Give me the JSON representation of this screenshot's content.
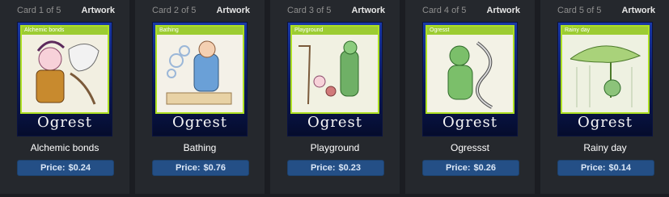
{
  "cards": [
    {
      "counter": "Card 1 of 5",
      "artwork_link": "Artwork",
      "mini_title": "Alchemic bonds",
      "logo": "Ogrest",
      "name": "Alchemic bonds",
      "price_label": "Price:",
      "price_value": "$0.24"
    },
    {
      "counter": "Card 2 of 5",
      "artwork_link": "Artwork",
      "mini_title": "Bathing",
      "logo": "Ogrest",
      "name": "Bathing",
      "price_label": "Price:",
      "price_value": "$0.76"
    },
    {
      "counter": "Card 3 of 5",
      "artwork_link": "Artwork",
      "mini_title": "Playground",
      "logo": "Ogrest",
      "name": "Playground",
      "price_label": "Price:",
      "price_value": "$0.23"
    },
    {
      "counter": "Card 4 of 5",
      "artwork_link": "Artwork",
      "mini_title": "Ogresst",
      "logo": "Ogrest",
      "name": "Ogressst",
      "price_label": "Price:",
      "price_value": "$0.26"
    },
    {
      "counter": "Card 5 of 5",
      "artwork_link": "Artwork",
      "mini_title": "Rainy day",
      "logo": "Ogrest",
      "name": "Rainy day",
      "price_label": "Price:",
      "price_value": "$0.14"
    }
  ]
}
